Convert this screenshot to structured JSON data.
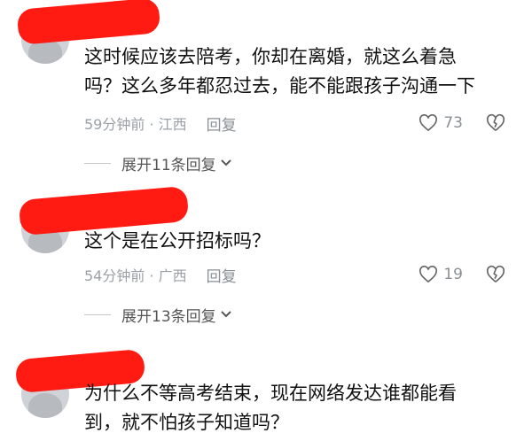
{
  "comments": [
    {
      "text_line1": "这时候应该去陪考，你却在离婚，就这么着急",
      "text_line2": "吗？这么多年都忍过去，能不能跟孩子沟通一下",
      "meta": "59分钟前 · 江西",
      "reply_label": "回复",
      "likes": "73",
      "expand_label": "展开11条回复"
    },
    {
      "text_line1": "这个是在公开招标吗？",
      "meta": "54分钟前 · 广西",
      "reply_label": "回复",
      "likes": "19",
      "expand_label": "展开13条回复"
    },
    {
      "text_line1": "为什么不等高考结束，现在网络发达谁都能看",
      "text_line2": "到，就不怕孩子知道吗？"
    }
  ],
  "colors": {
    "redaction": "#ff1a12",
    "meta": "#9aa0a6"
  },
  "icons": {
    "like": "heart-outline-icon",
    "dislike": "broken-heart-icon",
    "expand": "chevron-down-icon"
  }
}
